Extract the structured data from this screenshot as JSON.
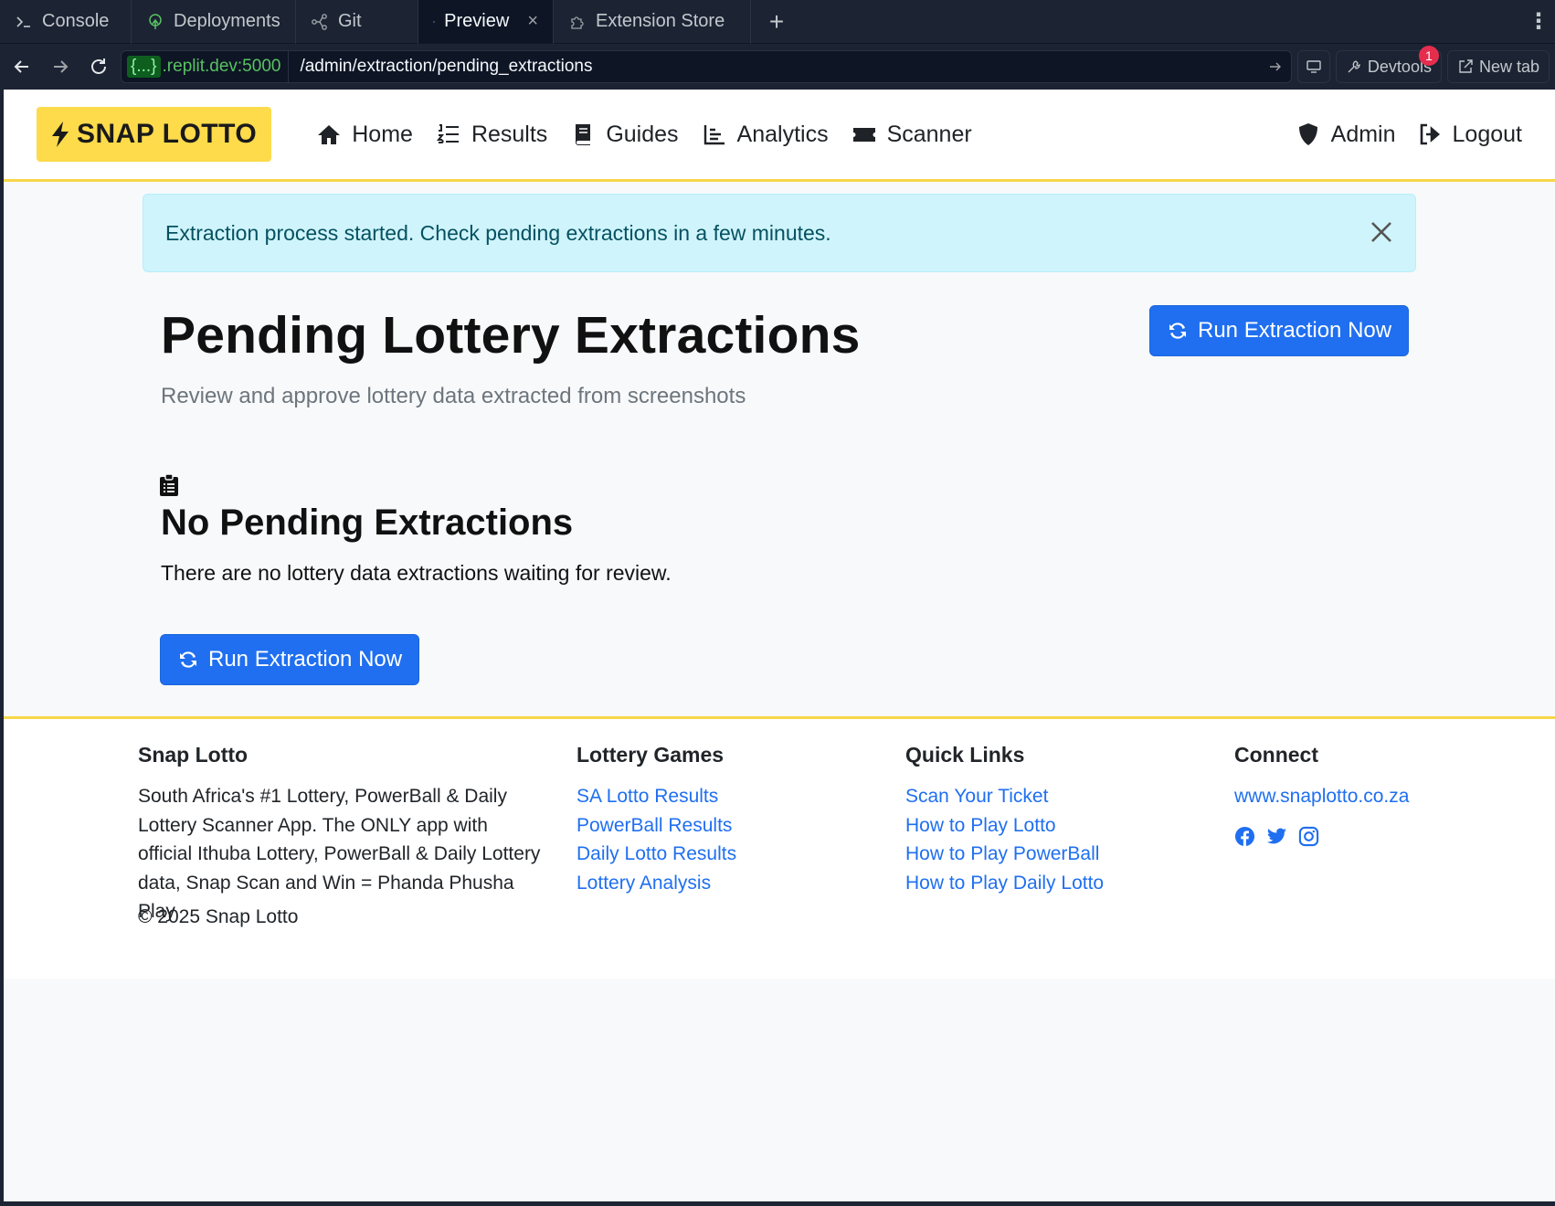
{
  "ide": {
    "tabs": [
      {
        "label": "Console",
        "icon": "terminal-icon"
      },
      {
        "label": "Deployments",
        "icon": "deployments-icon"
      },
      {
        "label": "Git",
        "icon": "git-icon"
      },
      {
        "label": "Preview",
        "icon": "monitor-icon",
        "active": true
      },
      {
        "label": "Extension Store",
        "icon": "puzzle-icon"
      }
    ],
    "url": {
      "brace": "{...}",
      "host": ".replit.dev:5000",
      "path": "/admin/extraction/pending_extractions"
    },
    "devtools_label": "Devtools",
    "devtools_badge": "1",
    "newtab_label": "New tab"
  },
  "site": {
    "brand": "SNAP LOTTO",
    "nav": {
      "home": "Home",
      "results": "Results",
      "guides": "Guides",
      "analytics": "Analytics",
      "scanner": "Scanner",
      "admin": "Admin",
      "logout": "Logout"
    },
    "alert": "Extraction process started. Check pending extractions in a few minutes.",
    "page": {
      "title": "Pending Lottery Extractions",
      "subtitle": "Review and approve lottery data extracted from screenshots",
      "run_button": "Run Extraction Now"
    },
    "empty_state": {
      "title": "No Pending Extractions",
      "text": "There are no lottery data extractions waiting for review.",
      "button": "Run Extraction Now"
    },
    "footer": {
      "about": {
        "heading": "Snap Lotto",
        "text": "South Africa's #1 Lottery, PowerBall & Daily Lottery Scanner App. The ONLY app with official Ithuba Lottery, PowerBall & Daily Lottery data, Snap Scan and Win = Phanda Phusha Play",
        "copyright": "© 2025 Snap Lotto"
      },
      "games": {
        "heading": "Lottery Games",
        "links": [
          "SA Lotto Results",
          "PowerBall Results",
          "Daily Lotto Results",
          "Lottery Analysis"
        ]
      },
      "quick": {
        "heading": "Quick Links",
        "links": [
          "Scan Your Ticket",
          "How to Play Lotto",
          "How to Play PowerBall",
          "How to Play Daily Lotto"
        ]
      },
      "connect": {
        "heading": "Connect",
        "website": "www.snaplotto.co.za",
        "social": [
          "facebook-icon",
          "twitter-icon",
          "instagram-icon"
        ]
      }
    }
  },
  "colors": {
    "accent_yellow": "#fddb4b",
    "primary_blue": "#1f6ff0",
    "alert_bg": "#cff4fc"
  }
}
